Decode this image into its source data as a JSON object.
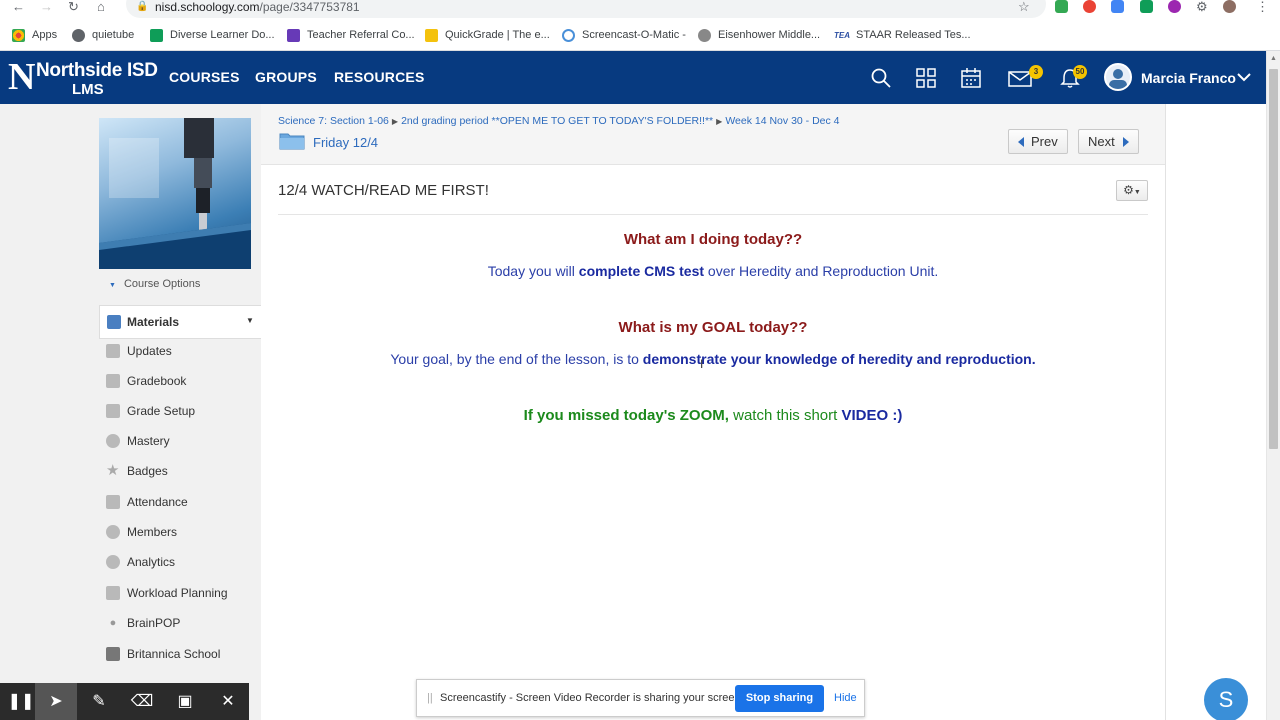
{
  "browser": {
    "url_domain": "nisd.schoology.com",
    "url_path": "/page/3347753781",
    "bookmarks": [
      {
        "label": "Apps",
        "color": "#e8453c"
      },
      {
        "label": "quietube",
        "color": "#5f6368"
      },
      {
        "label": "Diverse Learner Do...",
        "color": "#0f9d58"
      },
      {
        "label": "Teacher Referral Co...",
        "color": "#673ab7"
      },
      {
        "label": "QuickGrade | The e...",
        "color": "#f4c20d"
      },
      {
        "label": "Screencast-O-Matic -",
        "color": "#4a90d9"
      },
      {
        "label": "Eisenhower Middle...",
        "color": "#888888"
      },
      {
        "label": "STAAR Released Tes...",
        "color": "#2b4ea2"
      }
    ],
    "tea_label": "TEA"
  },
  "header": {
    "logo_name": "Northside ISD",
    "logo_sub": "LMS",
    "logo_letter": "N",
    "nav": [
      "COURSES",
      "GROUPS",
      "RESOURCES"
    ],
    "messages_badge": "3",
    "notifications_badge": "50",
    "user_name": "Marcia Franco"
  },
  "sidebar": {
    "course_options": "Course Options",
    "materials": "Materials",
    "items": [
      "Updates",
      "Gradebook",
      "Grade Setup",
      "Mastery",
      "Badges",
      "Attendance",
      "Members",
      "Analytics",
      "Workload Planning",
      "BrainPOP",
      "Britannica School"
    ]
  },
  "breadcrumb": {
    "parts": [
      "Science 7: Section 1-06",
      "2nd grading period **OPEN ME TO GET TO TODAY'S FOLDER!!**",
      "Week 14 Nov 30 - Dec 4"
    ],
    "folder": "Friday 12/4"
  },
  "pager": {
    "prev": "Prev",
    "next": "Next"
  },
  "page": {
    "title": "12/4 WATCH/READ ME FIRST!",
    "q1": "What am I doing today??",
    "l1_pre": "Today you will ",
    "l1_bold": "complete CMS test",
    "l1_post": " over Heredity and Reproduction Unit.",
    "q2": "What is my GOAL today??",
    "l2_pre": "Your goal, by the end of the lesson, is to ",
    "l2_bold": "demonstrate your knowledge of heredity and reproduction.",
    "l3_bold": "If you missed today's ZOOM,",
    "l3_mid": " watch this short ",
    "l3_video": "VIDEO",
    "l3_end": " :)"
  },
  "sharebar": {
    "text": "Screencastify - Screen Video Recorder is sharing your screen.",
    "stop": "Stop sharing",
    "hide": "Hide"
  },
  "bubble": "S",
  "colors": {
    "header_bg": "#073a80",
    "link": "#2d6bbd",
    "question": "#8b1a1a",
    "body_blue": "#2b3fa8",
    "green": "#1c8a1c",
    "stop_btn": "#1a73e8"
  }
}
